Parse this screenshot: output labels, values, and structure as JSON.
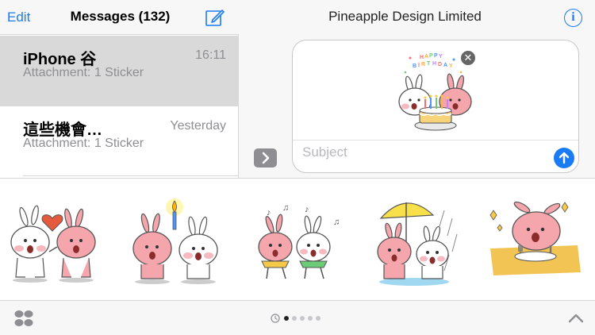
{
  "nav": {
    "edit_label": "Edit",
    "title": "Messages (132)",
    "compose_icon": "compose-icon"
  },
  "conversations": [
    {
      "name": "iPhone 谷",
      "time": "16:11",
      "preview": "Attachment: 1 Sticker",
      "selected": true
    },
    {
      "name": "這些機會…",
      "time": "Yesterday",
      "preview": "Attachment: 1 Sticker",
      "selected": false
    }
  ],
  "chat": {
    "title": "Pineapple Design Limited",
    "info_label": "i",
    "subject_placeholder": "Subject",
    "sticker_caption": "HAPPY BIRTHDAY"
  },
  "tray": {
    "stickers": [
      "bunnies-heart",
      "bunnies-candle",
      "bunnies-dancing",
      "bunnies-umbrella",
      "bunny-eating"
    ],
    "page_count": 5,
    "current_page": 1
  },
  "colors": {
    "accent": "#1a7cf5",
    "bunny_pink": "#f5a6ad",
    "cheek": "#f7b9c0"
  }
}
